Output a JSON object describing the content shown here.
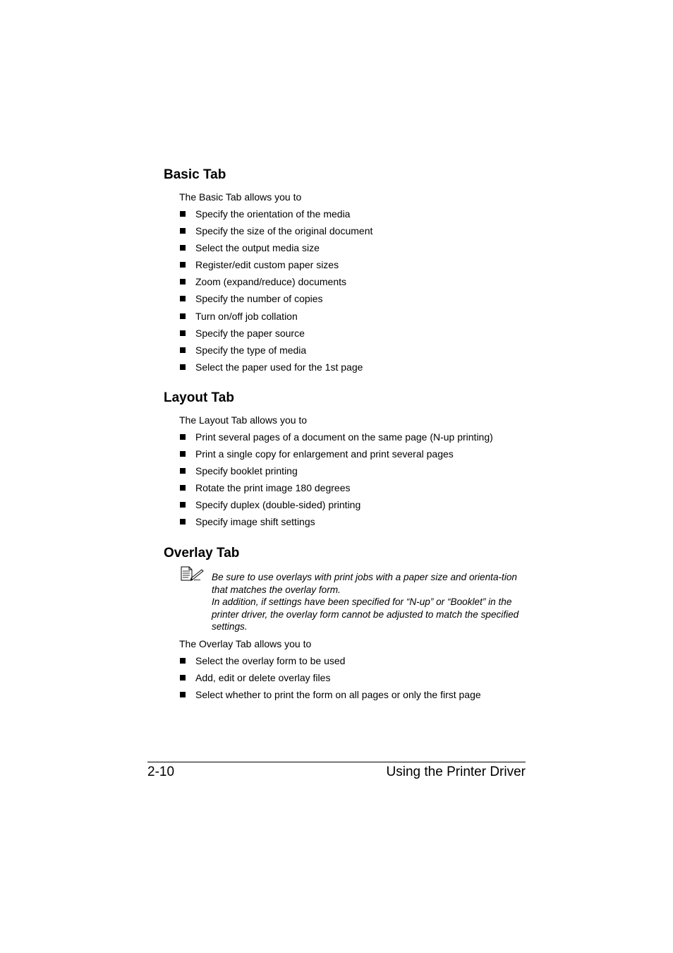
{
  "sections": [
    {
      "title": "Basic Tab",
      "intro": "The Basic Tab allows you to",
      "items": [
        "Specify the orientation of the media",
        "Specify the size of the original document",
        "Select the output media size",
        "Register/edit custom paper sizes",
        "Zoom (expand/reduce) documents",
        "Specify the number of copies",
        "Turn on/off job collation",
        "Specify the paper source",
        "Specify the type of media",
        "Select the paper used for the 1st page"
      ]
    },
    {
      "title": "Layout Tab",
      "intro": "The Layout Tab allows you to",
      "items": [
        "Print several pages of a document on the same page (N-up printing)",
        "Print a single copy for enlargement and print several pages",
        "Specify booklet printing",
        "Rotate the print image 180 degrees",
        "Specify duplex (double-sided) printing",
        "Specify image shift settings"
      ]
    },
    {
      "title": "Overlay Tab",
      "note": {
        "icon": "note-pencil-icon",
        "lines": [
          "Be sure to use overlays with print jobs with a paper size and orienta-tion that matches the overlay form.",
          "In addition, if settings have been specified for “N-up” or “Booklet” in the printer driver, the overlay form cannot be adjusted to match the specified settings."
        ]
      },
      "intro": "The Overlay Tab allows you to",
      "items": [
        "Select the overlay form to be used",
        "Add, edit or delete overlay files",
        "Select whether to print the form on all pages or only the first page"
      ]
    }
  ],
  "footer": {
    "page_number": "2-10",
    "chapter_title": "Using the Printer Driver"
  }
}
